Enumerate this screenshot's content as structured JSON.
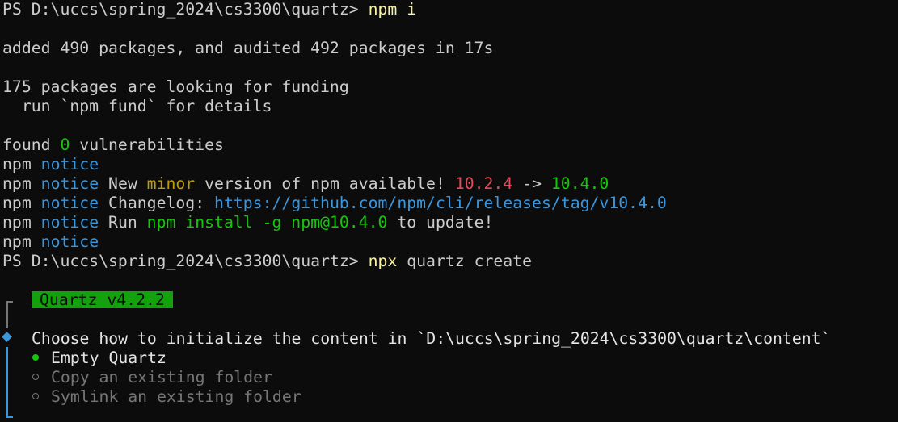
{
  "terminal": {
    "prompt": "PS D:\\uccs\\spring_2024\\cs3300\\quartz> ",
    "cmd1": "npm i",
    "added_line": "added 490 packages, and audited 492 packages in 17s",
    "funding_line": "175 packages are looking for funding",
    "fund_detail": "  run `npm fund` for details",
    "found_prefix": "found ",
    "found_count": "0",
    "found_suffix": " vulnerabilities",
    "npm": "npm",
    "notice": "notice",
    "new_text_a": " New ",
    "minor": "minor",
    "new_text_b": " version of npm available! ",
    "old_version": "10.2.4",
    "arrow": " -> ",
    "new_version": "10.4.0",
    "changelog_label": " Changelog: ",
    "changelog_url": "https://github.com/npm/cli/releases/tag/v10.4.0",
    "run_label": " Run ",
    "run_cmd": "npm install -g npm@10.4.0",
    "run_suffix": " to update!",
    "cmd2": "npx",
    "cmd2_args": " quartz create"
  },
  "quartz": {
    "banner": "Quartz v4.2.2",
    "question": "Choose how to initialize the content in `D:\\uccs\\spring_2024\\cs3300\\quartz\\content`",
    "options": [
      {
        "label": "Empty Quartz",
        "selected": true
      },
      {
        "label": "Copy an existing folder",
        "selected": false
      },
      {
        "label": "Symlink an existing folder",
        "selected": false
      }
    ]
  },
  "colors": {
    "background": "#0c0c0c",
    "text": "#cccccc",
    "command": "#f9f1a5",
    "notice": "#3a96dd",
    "green": "#16c60c",
    "minor": "#c19c00",
    "old_version": "#e74856",
    "banner_bg": "#13a10e",
    "dim": "#767676"
  }
}
